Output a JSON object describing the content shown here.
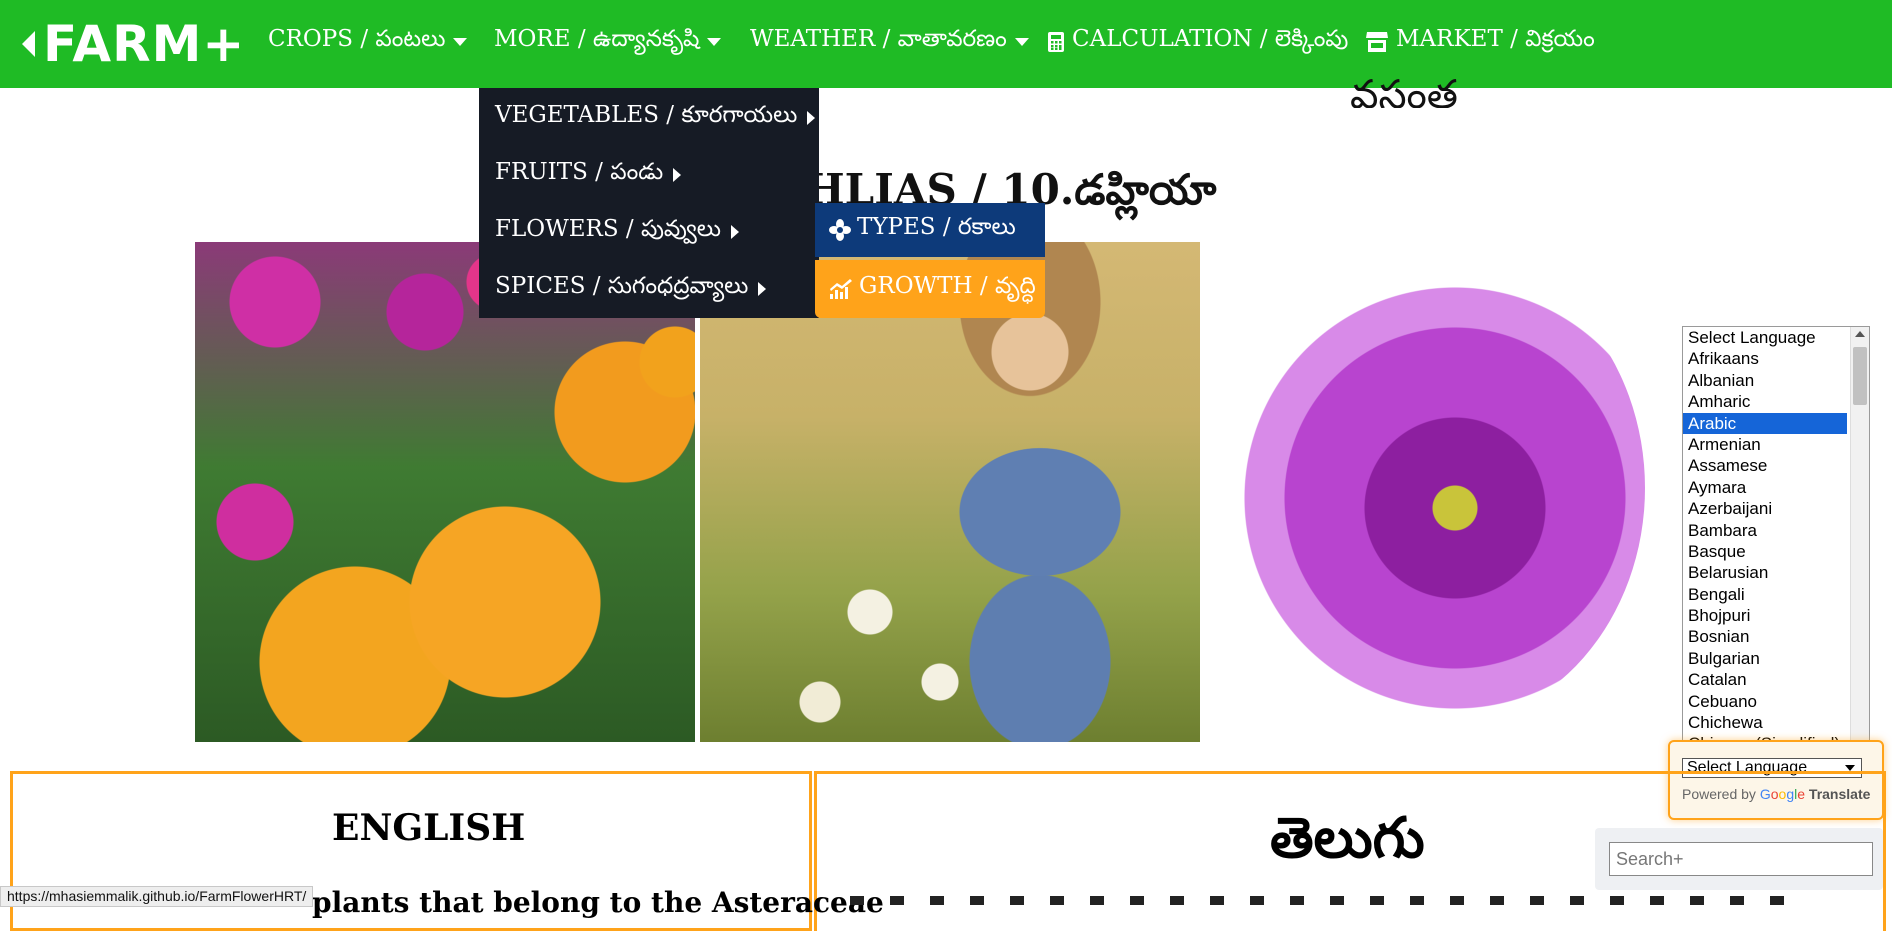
{
  "brand": {
    "logo": "FARM+"
  },
  "nav": {
    "crops": "CROPS / పంటలు",
    "more": "MORE / ఉద్యానకృషి",
    "weather": "WEATHER / వాతావరణం",
    "calculation": "CALCULATION / లెక్కింపు",
    "market": "MARKET / విక్రయం"
  },
  "dropdown": {
    "items": [
      {
        "label": "VEGETABLES / కూరగాయలు"
      },
      {
        "label": "FRUITS / పండు"
      },
      {
        "label": "FLOWERS / పువ్వులు"
      },
      {
        "label": "SPICES / సుగంధద్రవ్యాలు"
      }
    ],
    "submenu": {
      "types": "TYPES / రకాలు",
      "growth": "GROWTH / వృద్ధి"
    }
  },
  "page": {
    "partial_heading": "వసంత",
    "title": "HLIAS / 10.డహ్లియా"
  },
  "language_list": {
    "options": [
      "Select Language",
      "Afrikaans",
      "Albanian",
      "Amharic",
      "Arabic",
      "Armenian",
      "Assamese",
      "Aymara",
      "Azerbaijani",
      "Bambara",
      "Basque",
      "Belarusian",
      "Bengali",
      "Bhojpuri",
      "Bosnian",
      "Bulgarian",
      "Catalan",
      "Cebuano",
      "Chichewa",
      "Chinese (Simplified)"
    ],
    "selected": "Arabic"
  },
  "translate_widget": {
    "select_value": "Select Language",
    "powered_by": "Powered by",
    "google": "Google",
    "translate": "Translate"
  },
  "sections": {
    "english_title": "ENGLISH",
    "english_text": "plants that belong to the Asteraceae",
    "telugu_title": "తెలుగు"
  },
  "search": {
    "placeholder": "Search+"
  },
  "status_bar": {
    "url": "https://mhasiemmalik.github.io/FarmFlowerHRT/"
  }
}
